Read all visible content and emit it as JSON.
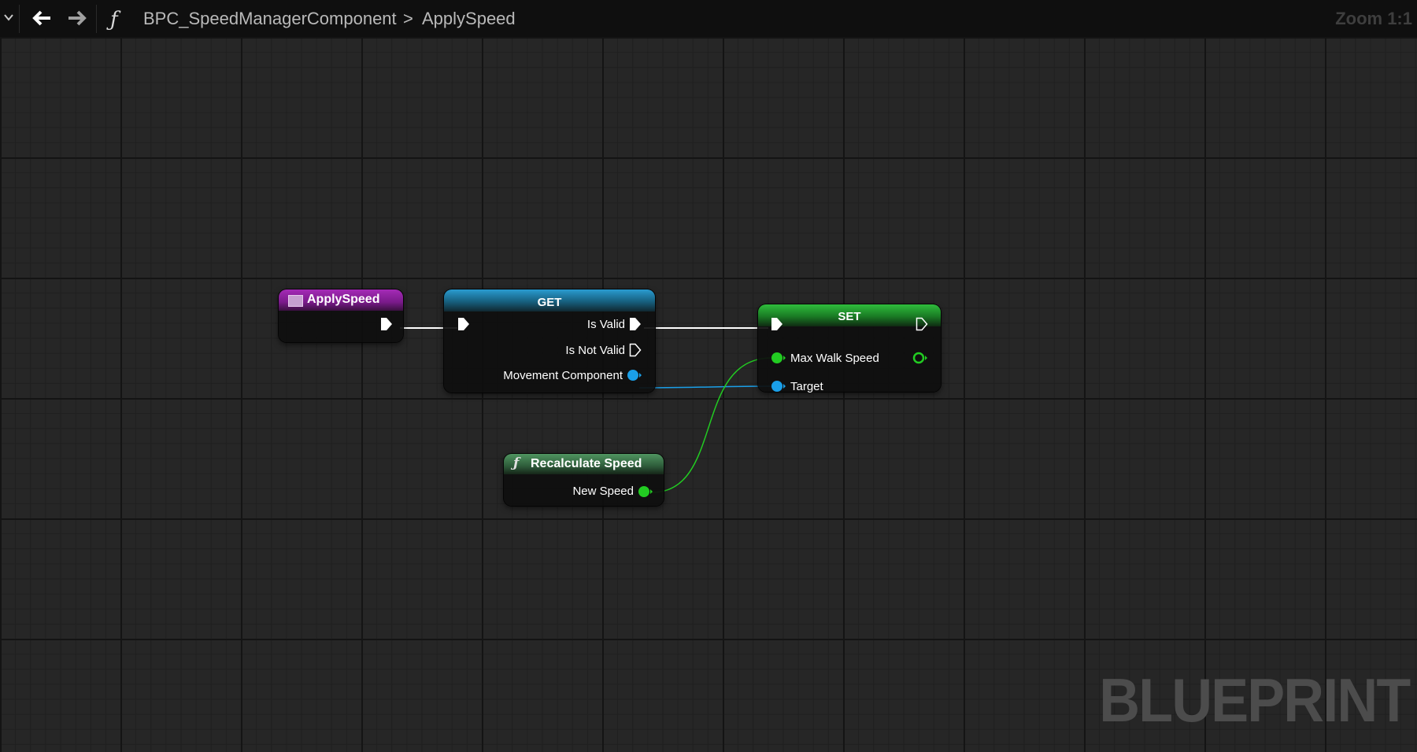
{
  "toolbar": {
    "breadcrumb_blueprint": "BPC_SpeedManagerComponent",
    "breadcrumb_separator": ">",
    "breadcrumb_function": "ApplySpeed",
    "zoom": "Zoom 1:1",
    "icons": [
      "chevron-down-icon",
      "back-arrow-icon",
      "forward-arrow-icon",
      "function-icon"
    ]
  },
  "nodes": {
    "entry": {
      "title": "ApplySpeed"
    },
    "get": {
      "title": "GET",
      "pins": {
        "is_valid": "Is Valid",
        "is_not_valid": "Is Not Valid",
        "movement_component": "Movement Component"
      }
    },
    "set": {
      "title": "SET",
      "pins": {
        "max_walk_speed": "Max Walk Speed",
        "target": "Target"
      }
    },
    "recalc": {
      "title": "Recalculate Speed",
      "pins": {
        "new_speed": "New Speed"
      }
    }
  },
  "watermark": "BLUEPRINT",
  "colors": {
    "entry_header": "#8e1a9e",
    "get_header": "#1b7fb0",
    "set_header": "#1d8f2a",
    "recalc_header": "#3e7a4c",
    "float_pin": "#22cc22",
    "object_pin": "#1a9fe8",
    "exec_pin": "#ffffff"
  }
}
